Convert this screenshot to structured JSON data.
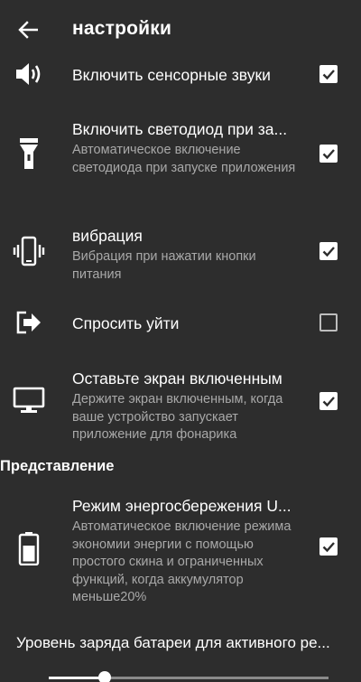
{
  "toolbar": {
    "title": "настройки",
    "back_icon": "arrow-left-icon"
  },
  "settings": [
    {
      "icon": "speaker-icon",
      "title": "Включить сенсорные звуки",
      "summary": "",
      "checked": true
    },
    {
      "icon": "flashlight-icon",
      "title": "Включить светодиод при за...",
      "summary": "Автоматическое включение светодиода при запуске приложения",
      "checked": true
    },
    {
      "icon": "phone-vibrate-icon",
      "title": "вибрация",
      "summary": "Вибрация при нажатии кнопки питания",
      "checked": true
    },
    {
      "icon": "exit-icon",
      "title": "Спросить уйти",
      "summary": "",
      "checked": false
    },
    {
      "icon": "monitor-icon",
      "title": "Оставьте экран включенным",
      "summary": "Держите экран включенным, когда ваше устройство запускает приложение для фонарика",
      "checked": true
    }
  ],
  "section": {
    "header": "Представление"
  },
  "power_saving": {
    "icon": "battery-icon",
    "title": "Режим энергосбережения U...",
    "summary": "Автоматическое включение режима экономии энергии с помощью простого скина и ограниченных функций, когда аккумулятор меньше20%",
    "checked": true
  },
  "battery_level": {
    "title": "Уровень заряда батареи для активного ре...",
    "value_fraction": 0.2
  },
  "colors": {
    "background": "#2d2d2d",
    "text_primary": "#ffffff",
    "text_secondary": "#a9a9a9"
  }
}
